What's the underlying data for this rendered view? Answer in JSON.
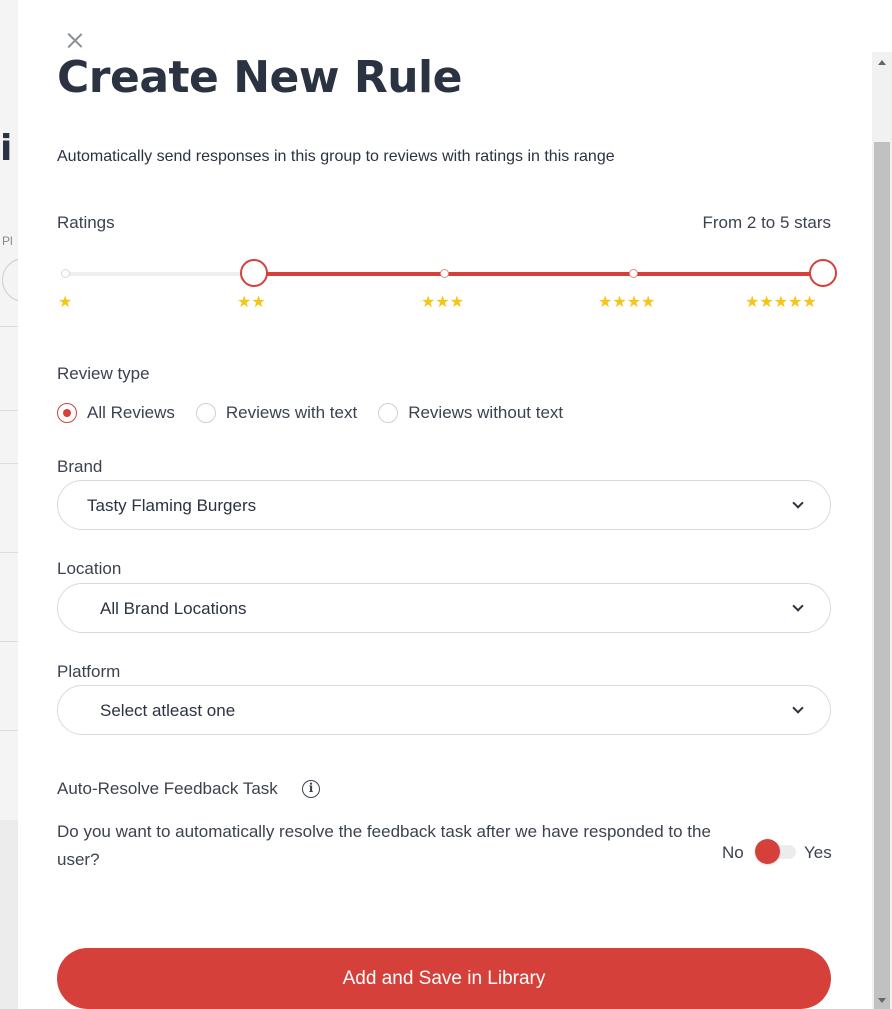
{
  "modal": {
    "title": "Create New Rule",
    "subtitle": "Automatically send responses in this group to reviews with ratings in this range",
    "close_icon": "close-icon"
  },
  "ratings": {
    "label": "Ratings",
    "range_text": "From 2 to 5 stars",
    "min": 2,
    "max": 5,
    "options": [
      {
        "stars": "★"
      },
      {
        "stars": "★★"
      },
      {
        "stars": "★★★"
      },
      {
        "stars": "★★★★"
      },
      {
        "stars": "★★★★★"
      }
    ],
    "accent_color": "#d6403a",
    "star_color": "#f5c518"
  },
  "review_type": {
    "label": "Review type",
    "options": [
      {
        "label": "All Reviews",
        "selected": true
      },
      {
        "label": "Reviews with text",
        "selected": false
      },
      {
        "label": "Reviews without text",
        "selected": false
      }
    ]
  },
  "brand": {
    "label": "Brand",
    "value": "Tasty Flaming Burgers"
  },
  "location": {
    "label": "Location",
    "value": "All Brand Locations"
  },
  "platform": {
    "label": "Platform",
    "value": "Select atleast one"
  },
  "auto_resolve": {
    "label": "Auto-Resolve Feedback Task",
    "info_icon": "info-icon",
    "question": "Do you want to automatically resolve the feedback task after we have responded to the user?",
    "no_label": "No",
    "yes_label": "Yes",
    "enabled": false
  },
  "submit": {
    "label": "Add and Save in Library"
  }
}
